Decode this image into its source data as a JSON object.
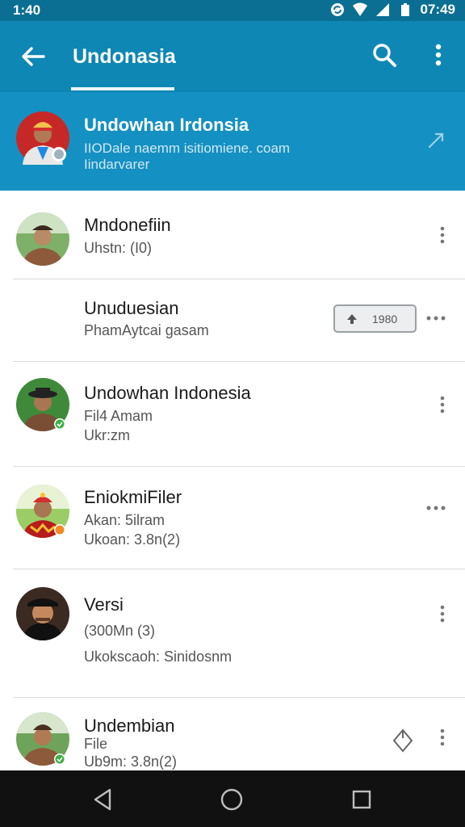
{
  "status_bar": {
    "time": "1:40",
    "clock": "07:49",
    "icons": [
      "sync-icon",
      "wifi-icon",
      "signal-icon",
      "battery-icon"
    ]
  },
  "app_bar": {
    "title": "Undonasia",
    "icons": [
      "back-arrow-icon",
      "search-icon",
      "more-vert-icon"
    ]
  },
  "featured": {
    "name": "Undowhan Irdonsia",
    "line1": "IIODale naemm isitiomiene. coam",
    "line2": "Iindarvarer"
  },
  "rows": [
    {
      "name": "Mndonefiin",
      "line1": "Uhstn: (I0)",
      "line2": "",
      "action": "more-vert"
    },
    {
      "name": "Unuduesian",
      "line1": "PhamAytcai gasam",
      "line2": "",
      "action": "more-horiz",
      "pill_value": "1980"
    },
    {
      "name": "Undowhan Indonesia",
      "line1": "Fil4 Amam",
      "line2": "Ukr:zm",
      "action": "more-vert"
    },
    {
      "name": "EniokmiFiler",
      "line1": "Akan: 5ilram",
      "line2": "Ukoan: 3.8n(2)",
      "action": "more-horiz"
    },
    {
      "name": "Versi",
      "line1": "(300Mn (3)",
      "line2": "Ukokscaoh: Sinidosnm",
      "action": "more-vert"
    },
    {
      "name": "Undembian",
      "line1": "File",
      "line2": "Ub9m: 3.8n(2)",
      "action": "more-vert"
    }
  ],
  "colors": {
    "status_bar": "#0b6f93",
    "app_bar": "#0e87b5",
    "featured_bg": "#1590c2",
    "verified_badge": "#3cb043",
    "orange_badge": "#f08a24",
    "nav_bar": "#111111"
  },
  "nav": [
    "back-triangle-icon",
    "home-circle-icon",
    "recents-square-icon"
  ]
}
